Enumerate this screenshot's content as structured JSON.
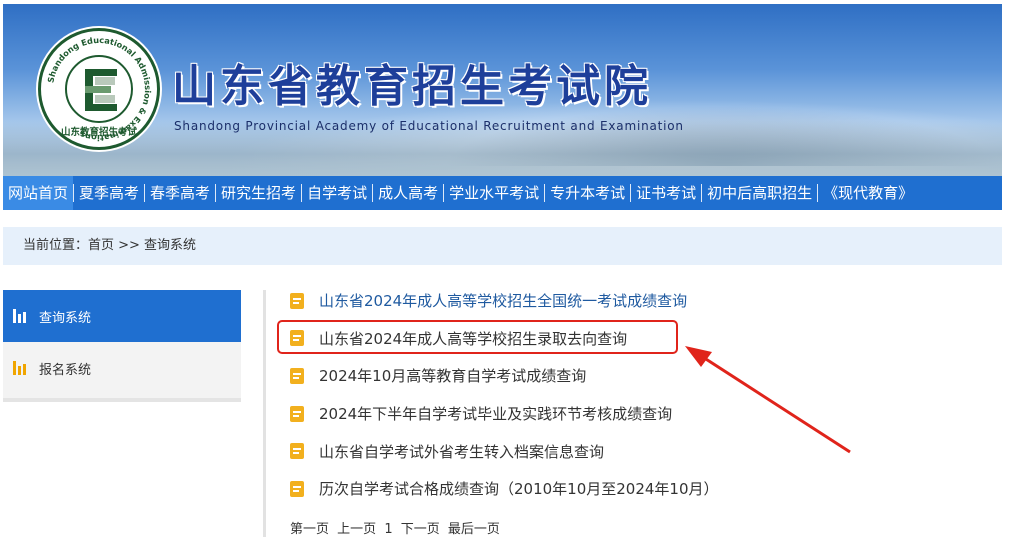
{
  "header": {
    "title": "山东省教育招生考试院",
    "subtitle": "Shandong Provincial Academy of Educational Recruitment and Examination",
    "logo": {
      "ring_text": "Shandong Educational Admission & Examinations",
      "bottom_text": "山东教育招生考试"
    }
  },
  "nav": {
    "items": [
      {
        "label": "网站首页",
        "active": true
      },
      {
        "label": "夏季高考"
      },
      {
        "label": "春季高考"
      },
      {
        "label": "研究生招考"
      },
      {
        "label": "自学考试"
      },
      {
        "label": "成人高考"
      },
      {
        "label": "学业水平考试"
      },
      {
        "label": "专升本考试"
      },
      {
        "label": "证书考试"
      },
      {
        "label": "初中后高职招生"
      },
      {
        "label": "《现代教育》"
      }
    ]
  },
  "breadcrumb": {
    "text": "当前位置：首页 >> 查询系统"
  },
  "sidebar": {
    "items": [
      {
        "label": "查询系统",
        "icon": "bar-chart-icon",
        "active": true
      },
      {
        "label": "报名系统",
        "icon": "bar-chart-icon"
      }
    ]
  },
  "list": {
    "items": [
      {
        "label": "山东省2024年成人高等学校招生全国统一考试成绩查询",
        "icon": "document-icon"
      },
      {
        "label": "山东省2024年成人高等学校招生录取去向查询",
        "icon": "document-icon",
        "highlighted": true
      },
      {
        "label": "2024年10月高等教育自学考试成绩查询",
        "icon": "document-icon"
      },
      {
        "label": "2024年下半年自学考试毕业及实践环节考核成绩查询",
        "icon": "document-icon"
      },
      {
        "label": "山东省自学考试外省考生转入档案信息查询",
        "icon": "document-icon"
      },
      {
        "label": "历次自学考试合格成绩查询（2010年10月至2024年10月）",
        "icon": "document-icon"
      }
    ]
  },
  "pager": {
    "first": "第一页",
    "prev": "上一页",
    "current": "1",
    "next": "下一页",
    "last": "最后一页"
  },
  "colors": {
    "nav_bg": "#1f6fd0",
    "link": "#1f5aa0",
    "icon_accent": "#f2b01e",
    "annotation": "#e0241b"
  }
}
